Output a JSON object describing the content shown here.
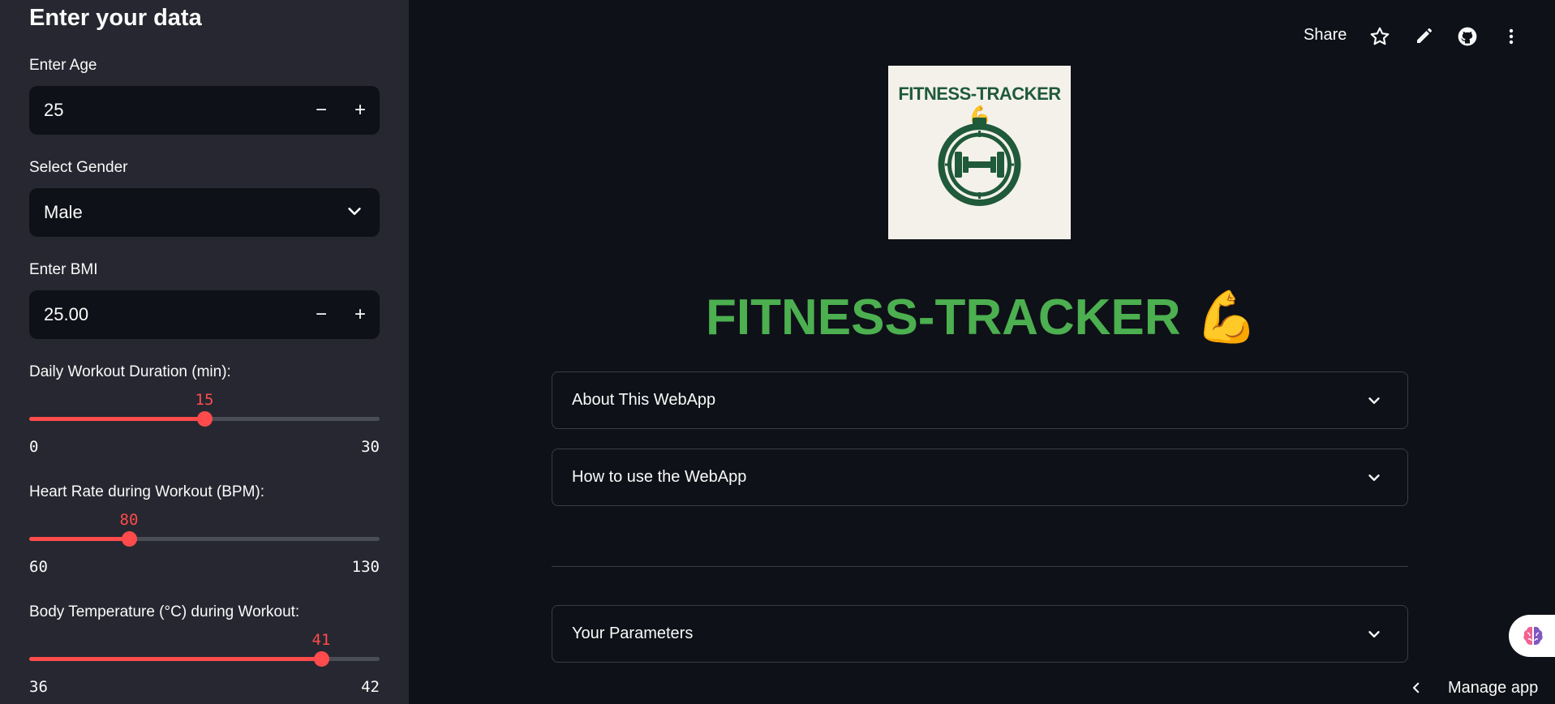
{
  "sidebar": {
    "title": "Enter your data",
    "age": {
      "label": "Enter Age",
      "value": "25"
    },
    "gender": {
      "label": "Select Gender",
      "value": "Male"
    },
    "bmi": {
      "label": "Enter BMI",
      "value": "25.00"
    },
    "duration": {
      "label": "Daily Workout Duration (min):",
      "value": "15",
      "min": "0",
      "max": "30",
      "fraction": 0.5
    },
    "heart_rate": {
      "label": "Heart Rate during Workout (BPM):",
      "value": "80",
      "min": "60",
      "max": "130",
      "fraction": 0.2857
    },
    "body_temp": {
      "label": "Body Temperature (°C) during Workout:",
      "value": "41",
      "min": "36",
      "max": "42",
      "fraction": 0.8333
    }
  },
  "toolbar": {
    "share_label": "Share",
    "icons": [
      "star-icon",
      "pencil-icon",
      "github-icon",
      "more-vertical-icon"
    ]
  },
  "main": {
    "logo_text": "FITNESS-TRACKER💪",
    "title": "FITNESS-TRACKER",
    "title_emoji": "💪",
    "expanders": [
      {
        "label": "About This WebApp"
      },
      {
        "label": "How to use the WebApp"
      },
      {
        "label": "Your Parameters"
      }
    ]
  },
  "footer": {
    "manage_app_label": "Manage app"
  },
  "colors": {
    "accent": "#ff4b4b",
    "title_green": "#4caf50",
    "sidebar_bg": "#262730",
    "main_bg": "#0e1117",
    "logo_green": "#1f5a3a"
  }
}
